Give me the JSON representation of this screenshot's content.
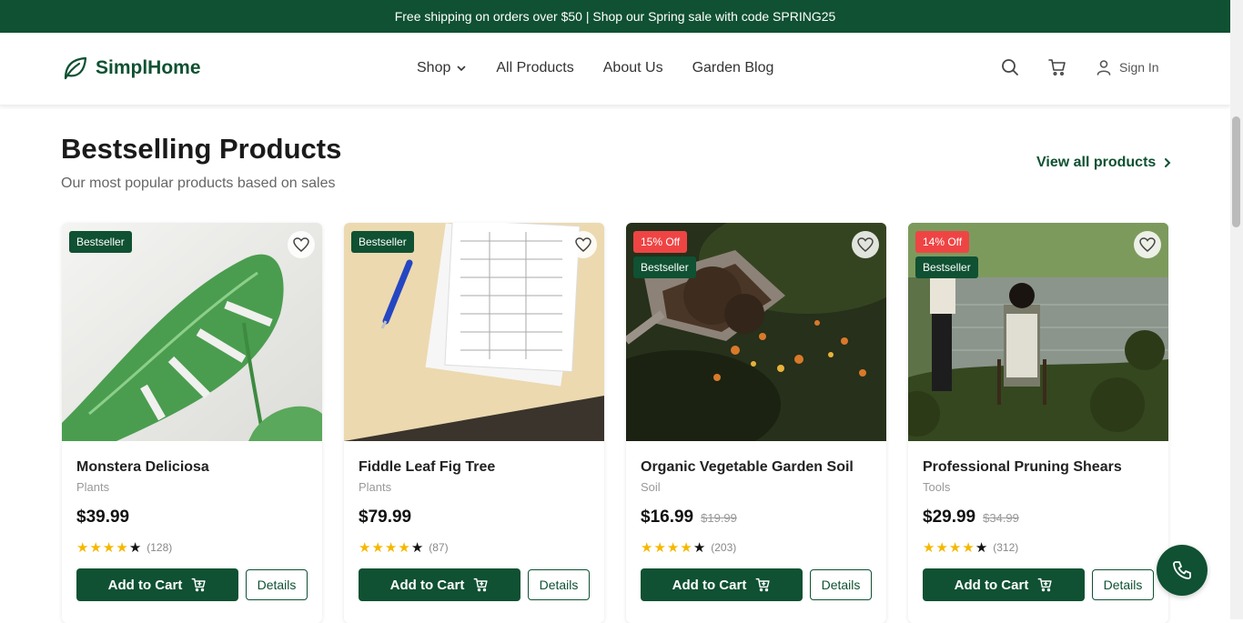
{
  "banner": {
    "text": "Free shipping on orders over $50 | Shop our Spring sale with code SPRING25"
  },
  "header": {
    "logo_text": "SimplHome",
    "nav": [
      {
        "label": "Shop",
        "has_dropdown": true
      },
      {
        "label": "All Products"
      },
      {
        "label": "About Us"
      },
      {
        "label": "Garden Blog"
      }
    ],
    "icons": [
      "search-icon",
      "cart-icon",
      "user-icon"
    ],
    "signin_label": "Sign In"
  },
  "section": {
    "title": "Bestselling Products",
    "subtitle": "Our most popular products based on sales",
    "view_all": "View all products"
  },
  "products": [
    {
      "name": "Monstera Deliciosa",
      "category": "Plants",
      "price": "$39.99",
      "old_price": "",
      "discount": "",
      "badge": "Bestseller",
      "rating": 4,
      "reviews": "(128)"
    },
    {
      "name": "Fiddle Leaf Fig Tree",
      "category": "Plants",
      "price": "$79.99",
      "old_price": "",
      "discount": "",
      "badge": "Bestseller",
      "rating": 4,
      "reviews": "(87)"
    },
    {
      "name": "Organic Vegetable Garden Soil",
      "category": "Soil",
      "price": "$16.99",
      "old_price": "$19.99",
      "discount": "15% Off",
      "badge": "Bestseller",
      "rating": 4,
      "reviews": "(203)"
    },
    {
      "name": "Professional Pruning Shears",
      "category": "Tools",
      "price": "$29.99",
      "old_price": "$34.99",
      "discount": "14% Off",
      "badge": "Bestseller",
      "rating": 4,
      "reviews": "(312)"
    }
  ],
  "buttons": {
    "add_to_cart": "Add to Cart",
    "details": "Details"
  },
  "colors": {
    "brand": "#0f5132",
    "discount": "#ef4444",
    "star": "#f5b800"
  }
}
